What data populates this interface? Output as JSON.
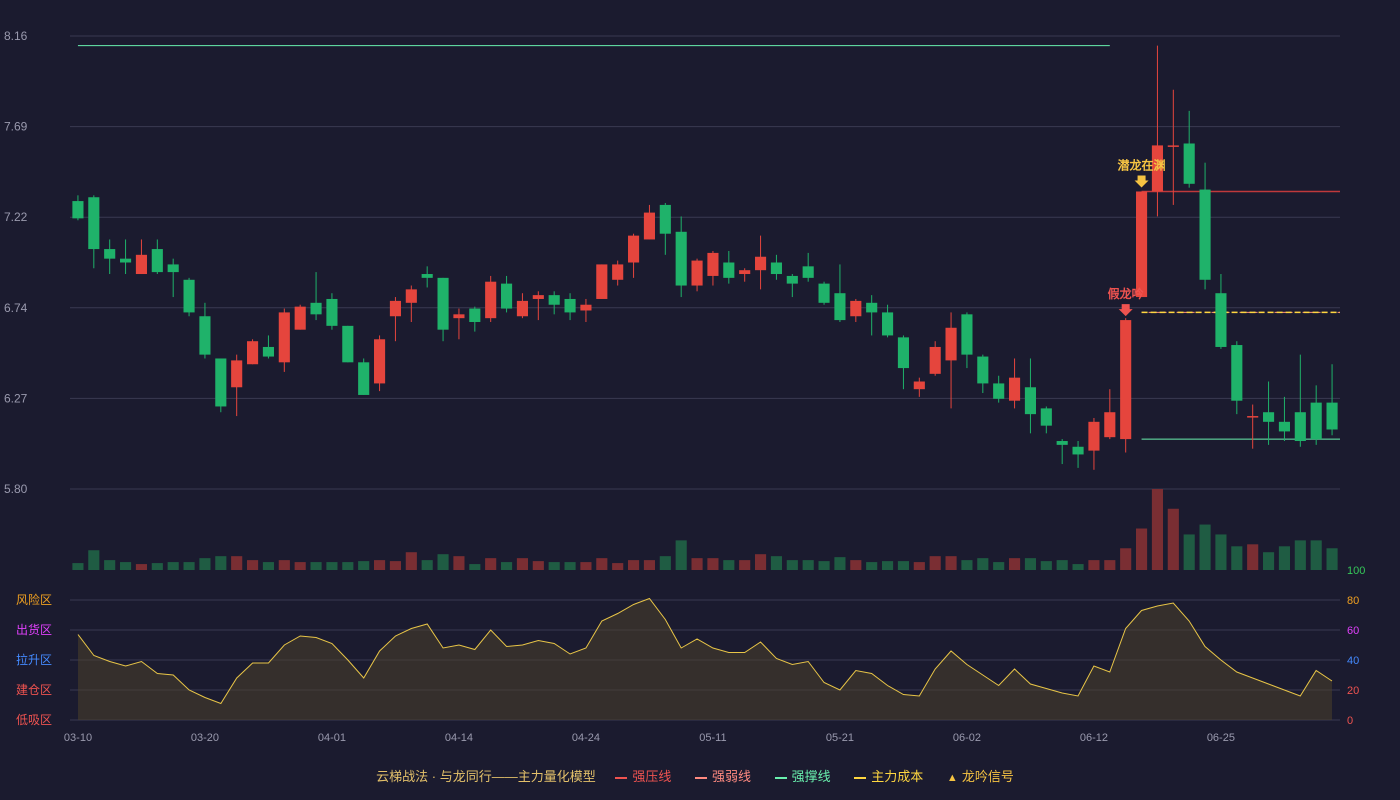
{
  "chart_data": [
    {
      "type": "candlestick",
      "title": "",
      "ylim": [
        5.8,
        8.16
      ],
      "y_ticks": [
        "8.16",
        "7.69",
        "7.22",
        "6.74",
        "6.27",
        "5.80"
      ],
      "x_ticks": [
        "03-10",
        "03-20",
        "04-01",
        "04-14",
        "04-24",
        "05-11",
        "05-21",
        "06-02",
        "06-12",
        "06-25"
      ],
      "x_tick_index": [
        0,
        8,
        16,
        24,
        32,
        40,
        48,
        56,
        64,
        72
      ],
      "candles": [
        [
          7.3,
          7.21,
          7.33,
          7.2
        ],
        [
          7.32,
          7.05,
          7.33,
          6.95
        ],
        [
          7.05,
          7.0,
          7.1,
          6.92
        ],
        [
          7.0,
          6.98,
          7.1,
          6.92
        ],
        [
          6.92,
          7.02,
          7.1,
          6.92
        ],
        [
          7.05,
          6.93,
          7.1,
          6.92
        ],
        [
          6.97,
          6.93,
          7.0,
          6.8
        ],
        [
          6.89,
          6.72,
          6.9,
          6.7
        ],
        [
          6.7,
          6.5,
          6.77,
          6.48
        ],
        [
          6.48,
          6.23,
          6.48,
          6.2
        ],
        [
          6.33,
          6.47,
          6.5,
          6.18
        ],
        [
          6.45,
          6.57,
          6.58,
          6.45
        ],
        [
          6.54,
          6.49,
          6.6,
          6.48
        ],
        [
          6.46,
          6.72,
          6.74,
          6.41
        ],
        [
          6.63,
          6.75,
          6.76,
          6.63
        ],
        [
          6.77,
          6.71,
          6.93,
          6.68
        ],
        [
          6.79,
          6.65,
          6.82,
          6.63
        ],
        [
          6.65,
          6.46,
          6.65,
          6.46
        ],
        [
          6.46,
          6.29,
          6.48,
          6.29
        ],
        [
          6.35,
          6.58,
          6.6,
          6.31
        ],
        [
          6.7,
          6.78,
          6.8,
          6.57
        ],
        [
          6.77,
          6.84,
          6.86,
          6.67
        ],
        [
          6.92,
          6.9,
          6.96,
          6.85
        ],
        [
          6.9,
          6.63,
          6.9,
          6.57
        ],
        [
          6.69,
          6.71,
          6.74,
          6.58
        ],
        [
          6.74,
          6.67,
          6.75,
          6.62
        ],
        [
          6.69,
          6.88,
          6.91,
          6.67
        ],
        [
          6.87,
          6.74,
          6.91,
          6.72
        ],
        [
          6.7,
          6.78,
          6.82,
          6.69
        ],
        [
          6.79,
          6.81,
          6.83,
          6.68
        ],
        [
          6.81,
          6.76,
          6.83,
          6.71
        ],
        [
          6.79,
          6.72,
          6.82,
          6.68
        ],
        [
          6.73,
          6.76,
          6.79,
          6.67
        ],
        [
          6.79,
          6.97,
          6.97,
          6.79
        ],
        [
          6.89,
          6.97,
          6.99,
          6.86
        ],
        [
          6.98,
          7.12,
          7.13,
          6.9
        ],
        [
          7.1,
          7.24,
          7.28,
          7.1
        ],
        [
          7.28,
          7.13,
          7.29,
          7.02
        ],
        [
          7.14,
          6.86,
          7.22,
          6.8
        ],
        [
          6.86,
          6.99,
          7.0,
          6.83
        ],
        [
          6.91,
          7.03,
          7.04,
          6.86
        ],
        [
          6.98,
          6.9,
          7.04,
          6.87
        ],
        [
          6.92,
          6.94,
          6.95,
          6.88
        ],
        [
          6.94,
          7.01,
          7.12,
          6.84
        ],
        [
          6.98,
          6.92,
          7.02,
          6.89
        ],
        [
          6.91,
          6.87,
          6.92,
          6.8
        ],
        [
          6.96,
          6.9,
          7.03,
          6.88
        ],
        [
          6.87,
          6.77,
          6.88,
          6.76
        ],
        [
          6.82,
          6.68,
          6.97,
          6.67
        ],
        [
          6.7,
          6.78,
          6.79,
          6.67
        ],
        [
          6.77,
          6.72,
          6.81,
          6.6
        ],
        [
          6.72,
          6.6,
          6.76,
          6.59
        ],
        [
          6.59,
          6.43,
          6.6,
          6.32
        ],
        [
          6.32,
          6.36,
          6.38,
          6.28
        ],
        [
          6.4,
          6.54,
          6.57,
          6.39
        ],
        [
          6.47,
          6.64,
          6.72,
          6.22
        ],
        [
          6.71,
          6.5,
          6.72,
          6.43
        ],
        [
          6.49,
          6.35,
          6.5,
          6.3
        ],
        [
          6.35,
          6.27,
          6.39,
          6.25
        ],
        [
          6.26,
          6.38,
          6.48,
          6.22
        ],
        [
          6.33,
          6.19,
          6.48,
          6.09
        ],
        [
          6.22,
          6.13,
          6.23,
          6.09
        ],
        [
          6.05,
          6.03,
          6.06,
          5.93
        ],
        [
          6.02,
          5.98,
          6.05,
          5.91
        ],
        [
          6.0,
          6.15,
          6.17,
          5.9
        ],
        [
          6.07,
          6.2,
          6.32,
          6.06
        ],
        [
          6.06,
          6.68,
          6.69,
          5.99
        ],
        [
          6.8,
          7.35,
          7.35,
          6.8
        ],
        [
          7.35,
          7.59,
          8.11,
          7.22
        ],
        [
          7.59,
          7.59,
          7.88,
          7.28
        ],
        [
          7.6,
          7.39,
          7.77,
          7.37
        ],
        [
          7.36,
          6.89,
          7.5,
          6.84
        ],
        [
          6.82,
          6.54,
          6.92,
          6.53
        ],
        [
          6.55,
          6.26,
          6.57,
          6.19
        ],
        [
          6.18,
          6.18,
          6.24,
          6.01
        ],
        [
          6.2,
          6.15,
          6.36,
          6.03
        ],
        [
          6.15,
          6.1,
          6.28,
          6.05
        ],
        [
          6.2,
          6.05,
          6.5,
          6.02
        ],
        [
          6.25,
          6.06,
          6.34,
          6.03
        ],
        [
          6.25,
          6.11,
          6.45,
          6.08
        ]
      ],
      "volume": {
        "values": [
          3.5,
          10,
          5,
          4,
          3,
          3.5,
          4,
          4,
          6,
          7,
          7,
          5,
          4,
          5,
          4,
          4,
          4,
          4,
          4.5,
          5,
          4.5,
          9,
          5,
          8,
          7,
          3,
          6,
          4,
          6,
          4.5,
          4,
          4,
          4,
          6,
          3.5,
          5,
          5,
          7,
          15,
          6,
          6,
          5,
          5,
          8,
          7,
          5,
          5,
          4.5,
          6.5,
          5,
          4,
          4.5,
          4.5,
          4,
          7,
          7,
          5,
          6,
          4,
          6,
          6,
          4.5,
          5,
          3,
          5,
          5,
          11,
          21,
          41,
          31,
          18,
          23,
          18,
          12,
          13,
          9,
          12,
          15,
          15,
          11
        ],
        "max_label": "100"
      },
      "series": [
        {
          "name": "强压线",
          "color": "#ef5350",
          "segment": {
            "from_index": 67,
            "to_index": 80,
            "value": 7.35
          }
        },
        {
          "name": "强弱线",
          "color": "#ff8a80",
          "segment": {
            "from_index": 67,
            "to_index": 80,
            "value": 6.72
          }
        },
        {
          "name": "强撑线",
          "color": "#69f0ae",
          "segments": [
            {
              "from_index": 0,
              "to_index": 65,
              "value": 8.11
            },
            {
              "from_index": 67,
              "to_index": 80,
              "value": 6.06
            }
          ]
        },
        {
          "name": "主力成本",
          "color": "#ffd740",
          "segment": {
            "from_index": 67,
            "to_index": 80,
            "value": 6.72
          }
        }
      ],
      "annotations": [
        {
          "text": "潜龙在渊",
          "index": 67,
          "value": 7.35,
          "color": "#f5c342"
        },
        {
          "text": "假龙吟",
          "index": 66,
          "value": 6.68,
          "color": "#ef5350"
        }
      ]
    },
    {
      "type": "area",
      "ylim": [
        0,
        100
      ],
      "y_ticks": [
        {
          "label": "100",
          "color": "#35c759"
        },
        {
          "label": "80",
          "color": "#f0a020"
        },
        {
          "label": "60",
          "color": "#e040fb"
        },
        {
          "label": "40",
          "color": "#448aff"
        },
        {
          "label": "20",
          "color": "#ef5350"
        },
        {
          "label": "0",
          "color": "#ef5350"
        }
      ],
      "zones": [
        {
          "label": "风险区",
          "color": "#f0a020"
        },
        {
          "label": "出货区",
          "color": "#e040fb"
        },
        {
          "label": "拉升区",
          "color": "#448aff"
        },
        {
          "label": "建仓区",
          "color": "#ef5350"
        },
        {
          "label": "低吸区",
          "color": "#ef5350"
        }
      ],
      "values": [
        57,
        43,
        39,
        36,
        39,
        31,
        30,
        20,
        15,
        11,
        28,
        38,
        38,
        50,
        56,
        55,
        51,
        40,
        28,
        46,
        56,
        61,
        64,
        48,
        50,
        47,
        60,
        49,
        50,
        53,
        51,
        44,
        48,
        66,
        71,
        77,
        81,
        67,
        48,
        54,
        48,
        45,
        45,
        52,
        41,
        37,
        39,
        25,
        20,
        33,
        31,
        23,
        17,
        16,
        34,
        46,
        37,
        30,
        23,
        34,
        24,
        21,
        18,
        16,
        36,
        32,
        61,
        73,
        76,
        78,
        66,
        49,
        40,
        32,
        28,
        24,
        20,
        16,
        33,
        26
      ],
      "line_color": "#e8c547",
      "fill_color": "#4a3f2a"
    }
  ],
  "legend": {
    "title": "云梯战法 · 与龙同行——主力量化模型",
    "items": [
      {
        "label": "强压线",
        "color": "#ef5350",
        "style": "solid"
      },
      {
        "label": "强弱线",
        "color": "#ff8a80",
        "style": "dash"
      },
      {
        "label": "强撑线",
        "color": "#69f0ae",
        "style": "solid"
      },
      {
        "label": "主力成本",
        "color": "#ffd740",
        "style": "dash"
      },
      {
        "label": "龙吟信号",
        "color": "#f5c342",
        "style": "triangle"
      }
    ]
  }
}
